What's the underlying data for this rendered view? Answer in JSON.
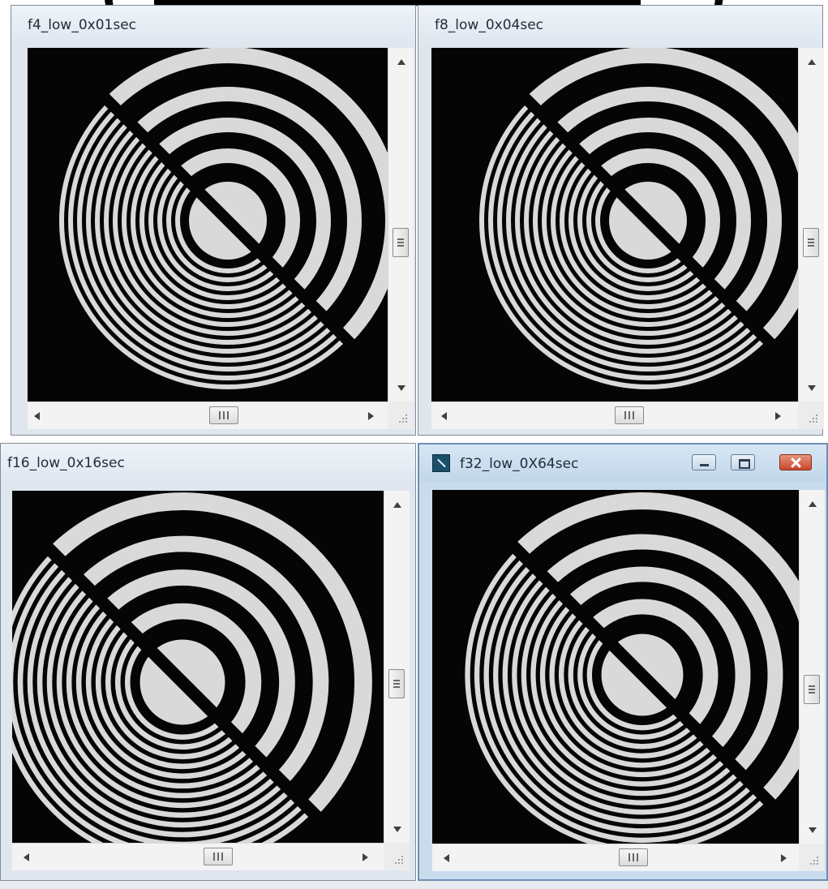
{
  "windows": [
    {
      "id": "w1",
      "title": "f4_low_0x01sec",
      "active": false
    },
    {
      "id": "w2",
      "title": "f8_low_0x04sec",
      "active": false
    },
    {
      "id": "w3",
      "title": "f16_low_0x16sec",
      "active": false
    },
    {
      "id": "w4",
      "title": "f32_low_0X64sec",
      "active": true
    }
  ],
  "icons": {
    "app": "image-viewer-icon",
    "minimize": "minimize-icon",
    "maximize": "maximize-icon",
    "close": "close-icon",
    "scroll_up": "arrow-up-icon",
    "scroll_down": "arrow-down-icon",
    "scroll_left": "arrow-left-icon",
    "scroll_right": "arrow-right-icon",
    "size_grip": "size-grip-icon"
  },
  "colors": {
    "pattern_light": "#d9d9d9",
    "pattern_dark": "#050505",
    "active_titlebar": "#c9dcee",
    "inactive_titlebar": "#e4eaf0"
  }
}
